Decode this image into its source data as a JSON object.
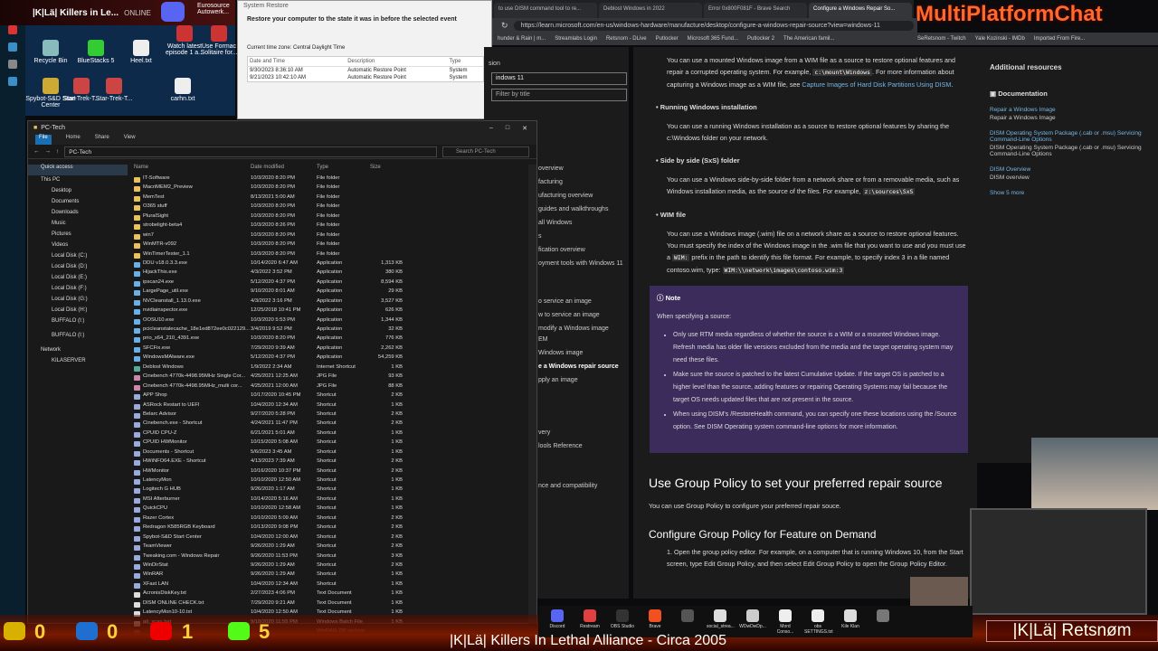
{
  "overlay": {
    "title": "|K|Lä| Killers in Le...",
    "status": "ONLINE"
  },
  "desktop": {
    "icons": [
      "Recycle Bin",
      "BlueStacks 5",
      "Heel.txt",
      "Watch latest episode 1 a...",
      "Use Formac Solitaire for...",
      "Eurosource Autowerk...",
      "Spybot-S&D Start Center",
      "Star-Trek-T...",
      "Star-Trek-T...",
      "carhn.txt"
    ]
  },
  "system_restore": {
    "window_title": "System Restore",
    "heading": "Restore your computer to the state it was in before the selected event",
    "timezone": "Current time zone: Central Daylight Time",
    "columns": [
      "Date and Time",
      "Description",
      "Type"
    ],
    "rows": [
      [
        "9/30/2023 8:36:10 AM",
        "Automatic Restore Point",
        "System"
      ],
      [
        "9/21/2023 10:42:10 AM",
        "Automatic Restore Point",
        "System"
      ]
    ]
  },
  "browser": {
    "tabs": [
      "to use DISM command tool to re...",
      "Deblost Windows in 2022",
      "Error 0x800F081F - Brave Search",
      "Configure a Windows Repair So..."
    ],
    "url": "https://learn.microsoft.com/en-us/windows-hardware/manufacture/desktop/configure-a-windows-repair-source?view=windows-11",
    "bookmarks": [
      "hunder & Rain | m...",
      "Streamlabs Login",
      "Retsnom - DLive",
      "Putlocker",
      "Microsoft 365 Fund...",
      "Putlocker 2",
      "The American famil...",
      "SeRetsnom - Twitch",
      "Yale Kozinski - IMDb",
      "Imported From Fire..."
    ]
  },
  "brand": {
    "text": "MultiPlatformChat"
  },
  "doc_nav": {
    "label": "sion",
    "version": "indows 11",
    "filter_placeholder": "Filter by title",
    "items": [
      "overview",
      "facturing",
      "ufacturing overview",
      "guides and walkthroughs",
      "all Windows",
      "s",
      "fication overview",
      "oyment tools with Windows 11",
      "o service an image",
      "w to service an image",
      "modify a Windows image",
      "EM",
      "Windows image",
      "e a Windows repair source",
      "pply an image",
      "very",
      "lools Reference",
      "nce and compatibility"
    ]
  },
  "doc": {
    "intro_a": "You can use a mounted Windows image from a WIM file as a source to restore optional features and repair a corrupted operating system. For example,",
    "intro_code": "c:\\mount\\Windows",
    "intro_b": ". For more information about capturing a Windows image as a WIM file, see",
    "intro_link": "Capture Images of Hard Disk Partitions Using DISM",
    "b1_title": "Running Windows installation",
    "b1_text": "You can use a running Windows installation as a source to restore optional features by sharing the c:\\Windows folder on your network.",
    "b2_title": "Side by side (SxS) folder",
    "b2_text": "You can use a Windows side-by-side folder from a network share or from a removable media, such as Windows installation media, as the source of the files. For example,",
    "b2_code": "z:\\sources\\SxS",
    "b3_title": "WIM file",
    "b3_text_a": "You can use a Windows image (.wim) file on a network share as a source to restore optional features. You must specify the index of the Windows image in the .wim file that you want to use and you must use a",
    "b3_code1": "WIM:",
    "b3_text_b": "prefix in the path to identify this file format. For example, to specify index 3 in a file named contoso.wim, type:",
    "b3_code2": "WIM:\\\\network\\images\\contoso.wim:3",
    "note_title": "Note",
    "note_intro": "When specifying a source:",
    "note_items": [
      "Only use RTM media regardless of whether the source is a WIM or a mounted Windows image. Refresh media has older file versions excluded from the media and the target operating system may need these files.",
      "Make sure the source is patched to the latest Cumulative Update. If the target OS is patched to a higher level than the source, adding features or repairing Operating Systems may fail because the target OS needs updated files that are not present in the source.",
      "When using DISM's /RestoreHealth command, you can specify one these locations using the /Source option. See DISM Operating system command-line options for more information."
    ],
    "h2": "Use Group Policy to set your preferred repair source",
    "h2_text": "You can use Group Policy to configure your preferred repair souce.",
    "h3": "Configure Group Policy for Feature on Demand",
    "step1": "1. Open the group policy editor. For example, on a computer that is running Windows 10, from the Start screen, type Edit Group Policy, and then select Edit Group Policy to open the Group Policy Editor."
  },
  "side": {
    "title": "Additional resources",
    "section": "Documentation",
    "links": [
      [
        "Repair a Windows Image",
        "Repair a Windows Image"
      ],
      [
        "DISM Operating System Package (.cab or .msu) Servicing Command-Line Options",
        "DISM Operating System Package (.cab or .msu) Servicing Command-Line Options"
      ],
      [
        "DISM Overview",
        "DISM overview"
      ]
    ],
    "more": "Show 5 more"
  },
  "explorer": {
    "title": "PC-Tech",
    "ribbon": [
      "File",
      "Home",
      "Share",
      "View"
    ],
    "path": "PC-Tech",
    "search": "Search PC-Tech",
    "tree": [
      "Quick access",
      "This PC",
      "Desktop",
      "Documents",
      "Downloads",
      "Music",
      "Pictures",
      "Videos",
      "Local Disk (C:)",
      "Local Disk (D:)",
      "Local Disk (E:)",
      "Local Disk (F:)",
      "Local Disk (G:)",
      "Local Disk (H:)",
      "BUFFALO (I:)",
      "BUFFALO (I:)",
      "Network",
      "KILASERVER"
    ],
    "columns": [
      "Name",
      "Date modified",
      "Type",
      "Size"
    ],
    "files": [
      [
        "IT-Software",
        "10/3/2020 8:20 PM",
        "File folder",
        ""
      ],
      [
        "MacriMEM2_Preview",
        "10/3/2020 8:20 PM",
        "File folder",
        ""
      ],
      [
        "MemTest",
        "8/13/2021 5:00 AM",
        "File folder",
        ""
      ],
      [
        "O365 stuff",
        "10/3/2020 8:20 PM",
        "File folder",
        ""
      ],
      [
        "PluralSight",
        "10/3/2020 8:20 PM",
        "File folder",
        ""
      ],
      [
        "strobelight-beta4",
        "10/3/2020 8:26 PM",
        "File folder",
        ""
      ],
      [
        "win7",
        "10/3/2020 8:20 PM",
        "File folder",
        ""
      ],
      [
        "WinMTR-v092",
        "10/3/2020 8:20 PM",
        "File folder",
        ""
      ],
      [
        "WinTimerTester_1.1",
        "10/3/2020 8:20 PM",
        "File folder",
        ""
      ],
      [
        "DDU v18.0.3.3.exe",
        "10/14/2020 6:47 AM",
        "Application",
        "1,313 KB"
      ],
      [
        "HijackThis.exe",
        "4/3/2022 3:52 PM",
        "Application",
        "380 KB"
      ],
      [
        "ipscan24.exe",
        "5/12/2020 4:37 PM",
        "Application",
        "8,594 KB"
      ],
      [
        "LargePage_util.exe",
        "9/10/2020 8:01 AM",
        "Application",
        "29 KB"
      ],
      [
        "NVCleanstall_1.13.0.exe",
        "4/3/2022 3:16 PM",
        "Application",
        "3,527 KB"
      ],
      [
        "nvidiainspector.exe",
        "12/25/2018 10:41 PM",
        "Application",
        "626 KB"
      ],
      [
        "OOSU10.exe",
        "10/3/2020 5:53 PM",
        "Application",
        "1,344 KB"
      ],
      [
        "pcicleanstalecache_18e1ed872ee0c022129...",
        "3/4/2019 9:52 PM",
        "Application",
        "32 KB"
      ],
      [
        "prio_x64_210_4391.exe",
        "10/3/2020 8:20 PM",
        "Application",
        "776 KB"
      ],
      [
        "SFCFix.exe",
        "7/29/2020 9:39 AM",
        "Application",
        "2,262 KB"
      ],
      [
        "WindowsMAlware.exe",
        "5/12/2020 4:37 PM",
        "Application",
        "54,259 KB"
      ],
      [
        "Deblost Windows",
        "1/9/2022 2:34 AM",
        "Internet Shortcut",
        "1 KB"
      ],
      [
        "Cinebench 4770k-4498.95MHz Single Cor...",
        "4/25/2021 12:25 AM",
        "JPG File",
        "93 KB"
      ],
      [
        "Cinebench 4770k-4498.95MHz_multi cor...",
        "4/25/2021 12:00 AM",
        "JPG File",
        "88 KB"
      ],
      [
        "APP Shop",
        "10/17/2020 10:45 PM",
        "Shortcut",
        "2 KB"
      ],
      [
        "ASRock Restart to UEFI",
        "10/4/2020 12:34 AM",
        "Shortcut",
        "1 KB"
      ],
      [
        "Belarc Advisor",
        "9/27/2020 5:28 PM",
        "Shortcut",
        "2 KB"
      ],
      [
        "Cinebench.exe - Shortcut",
        "4/24/2021 11:47 PM",
        "Shortcut",
        "2 KB"
      ],
      [
        "CPUID CPU-Z",
        "6/21/2021 5:01 AM",
        "Shortcut",
        "1 KB"
      ],
      [
        "CPUID HWMonitor",
        "10/15/2020 5:08 AM",
        "Shortcut",
        "1 KB"
      ],
      [
        "Documents - Shortcut",
        "5/6/2023 3:45 AM",
        "Shortcut",
        "1 KB"
      ],
      [
        "HWiNFO64.EXE - Shortcut",
        "4/13/2023 7:39 AM",
        "Shortcut",
        "2 KB"
      ],
      [
        "HWMonitor",
        "10/16/2020 10:37 PM",
        "Shortcut",
        "2 KB"
      ],
      [
        "LatencyMon",
        "10/10/2020 12:50 AM",
        "Shortcut",
        "1 KB"
      ],
      [
        "Logitech G HUB",
        "9/26/2020 1:17 AM",
        "Shortcut",
        "1 KB"
      ],
      [
        "MSI Afterburner",
        "10/14/2020 5:16 AM",
        "Shortcut",
        "1 KB"
      ],
      [
        "QuickCPU",
        "10/10/2020 12:58 AM",
        "Shortcut",
        "1 KB"
      ],
      [
        "Razer Cortex",
        "10/10/2020 5:09 AM",
        "Shortcut",
        "2 KB"
      ],
      [
        "Redragon K585RGB Keyboard",
        "10/13/2020 9:08 PM",
        "Shortcut",
        "2 KB"
      ],
      [
        "Spybot-S&D Start Center",
        "10/4/2020 12:00 AM",
        "Shortcut",
        "2 KB"
      ],
      [
        "TeamViewer",
        "9/26/2020 1:29 AM",
        "Shortcut",
        "2 KB"
      ],
      [
        "Tweaking.com - Windows Repair",
        "9/26/2020 11:53 PM",
        "Shortcut",
        "3 KB"
      ],
      [
        "WinDirStat",
        "9/26/2020 1:29 AM",
        "Shortcut",
        "2 KB"
      ],
      [
        "WinRAR",
        "9/26/2020 1:29 AM",
        "Shortcut",
        "1 KB"
      ],
      [
        "XFast LAN",
        "10/4/2020 12:34 AM",
        "Shortcut",
        "1 KB"
      ],
      [
        "AcronisDiskKey.txt",
        "2/27/2023 4:06 PM",
        "Text Document",
        "1 KB"
      ],
      [
        "DISM ONLINE CHECK.txt",
        "7/29/2020 9:21 AM",
        "Text Document",
        "1 KB"
      ],
      [
        "LatencyMon10-10.txt",
        "10/4/2020 12:50 AM",
        "Text Document",
        "1 KB"
      ],
      [
        "ati_scan.bat",
        "9/18/2020 11:55 PM",
        "Windows Batch File",
        "1 KB"
      ],
      [
        "",
        "",
        "WinRAR ZIP archive",
        ""
      ]
    ]
  },
  "taskbar": [
    "Discord",
    "Restream",
    "OBS Studio",
    "Brave",
    "",
    "social_strea...",
    "WDwDwDp...",
    "Mord Conso...",
    "obs SETTINGS.txt",
    "Kile Klan",
    ""
  ],
  "stream": {
    "stat1": "0",
    "stat2": "0",
    "stat3": "1",
    "stat4": "5",
    "bottom_title": "|K|Lä| Killers In Lethal Alliance - Circa 2005",
    "name": "|K|Lä| Retsnøm"
  },
  "colors": {
    "accent": "#75b6e7",
    "note_bg": "#3b2c5b",
    "brand": "#ff6a2a"
  }
}
